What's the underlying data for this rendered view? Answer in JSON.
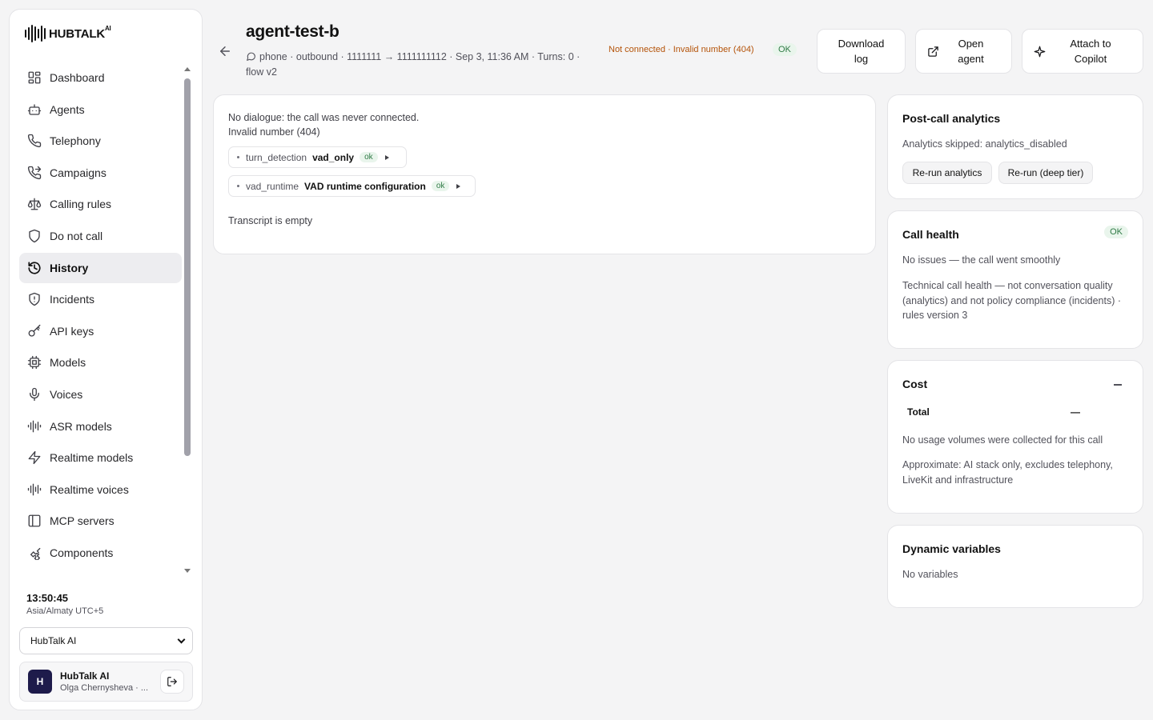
{
  "brand": {
    "name": "HUBTALK",
    "sup": "AI"
  },
  "nav": [
    {
      "label": "Dashboard",
      "icon": "dashboard-icon"
    },
    {
      "label": "Agents",
      "icon": "bot-icon"
    },
    {
      "label": "Telephony",
      "icon": "phone-icon"
    },
    {
      "label": "Campaigns",
      "icon": "phone-forward-icon"
    },
    {
      "label": "Calling rules",
      "icon": "scale-icon"
    },
    {
      "label": "Do not call",
      "icon": "shield-icon"
    },
    {
      "label": "History",
      "icon": "history-icon",
      "active": true
    },
    {
      "label": "Incidents",
      "icon": "shield-alert-icon"
    },
    {
      "label": "API keys",
      "icon": "key-icon"
    },
    {
      "label": "Models",
      "icon": "cpu-icon"
    },
    {
      "label": "Voices",
      "icon": "mic-icon"
    },
    {
      "label": "ASR models",
      "icon": "audio-lines-icon"
    },
    {
      "label": "Realtime models",
      "icon": "zap-icon"
    },
    {
      "label": "Realtime voices",
      "icon": "audio-lines-icon"
    },
    {
      "label": "MCP servers",
      "icon": "panel-icon"
    },
    {
      "label": "Components",
      "icon": "puzzle-icon"
    }
  ],
  "clock": {
    "time": "13:50:45",
    "tz": "Asia/Almaty UTC+5"
  },
  "org_select": {
    "value": "HubTalk AI"
  },
  "user": {
    "initial": "H",
    "name": "HubTalk AI",
    "sub": "Olga Chernysheva · ..."
  },
  "header": {
    "title": "agent-test-b",
    "channel": "phone",
    "meta": "· outbound · 1111111 → 1111111112 · Sep 3, 11:36 AM · Turns: 0 · flow v2",
    "status": "Not connected · Invalid number (404)",
    "badge": "OK"
  },
  "actions": {
    "download": "Download\nlog",
    "open": "Open\nagent",
    "attach": "Attach to\nCopilot"
  },
  "main": {
    "no_dialogue": "No dialogue: the call was never connected.",
    "reason": "Invalid number (404)",
    "chips": [
      {
        "key": "turn_detection",
        "value": "vad_only",
        "badge": "ok"
      },
      {
        "key": "vad_runtime",
        "value": "VAD runtime configuration",
        "badge": "ok"
      }
    ],
    "transcript": "Transcript is empty"
  },
  "analytics": {
    "title": "Post-call analytics",
    "status": "Analytics skipped: analytics_disabled",
    "rerun": "Re-run analytics",
    "rerun_deep": "Re-run (deep tier)"
  },
  "health": {
    "title": "Call health",
    "badge": "OK",
    "summary": "No issues — the call went smoothly",
    "note": "Technical call health — not conversation quality (analytics) and not policy compliance (incidents) · rules version 3"
  },
  "cost": {
    "title": "Cost",
    "total_label": "Total",
    "total_value": "—",
    "empty": "No usage volumes were collected for this call",
    "note": "Approximate: AI stack only, excludes telephony, LiveKit and infrastructure"
  },
  "variables": {
    "title": "Dynamic variables",
    "empty": "No variables"
  },
  "colors": {
    "status_warning": "#b45309",
    "ok_badge_bg": "#e9f5ec",
    "ok_badge_fg": "#2f7a45",
    "active_nav_bg": "#ededf0",
    "avatar_bg": "#1e1b4b"
  }
}
